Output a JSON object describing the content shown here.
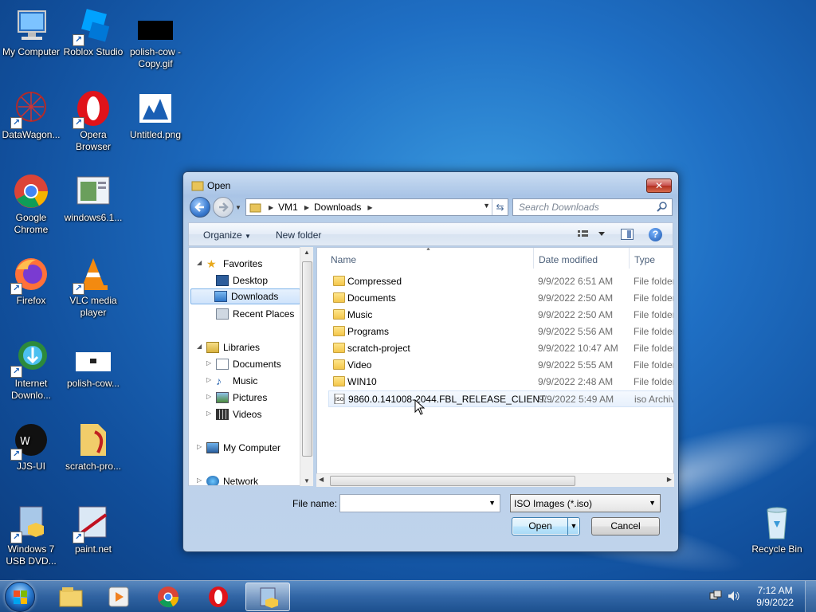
{
  "desktop": {
    "icons": [
      {
        "label": "My Computer",
        "icon": "computer-icon"
      },
      {
        "label": "Roblox Studio",
        "icon": "roblox-studio-icon"
      },
      {
        "label": "polish-cow - Copy.gif",
        "icon": "gif-thumbnail-icon"
      },
      {
        "label": "DataWagon...",
        "icon": "datawagon-icon"
      },
      {
        "label": "Opera Browser",
        "icon": "opera-icon"
      },
      {
        "label": "Untitled.png",
        "icon": "png-thumbnail-icon"
      },
      {
        "label": "Google Chrome",
        "icon": "chrome-icon"
      },
      {
        "label": "windows6.1...",
        "icon": "installer-icon"
      },
      {
        "label": "Firefox",
        "icon": "firefox-icon"
      },
      {
        "label": "VLC media player",
        "icon": "vlc-icon"
      },
      {
        "label": "Internet Downlo...",
        "icon": "idm-icon"
      },
      {
        "label": "polish-cow...",
        "icon": "gif-thumbnail-icon"
      },
      {
        "label": "JJS-UI",
        "icon": "jjs-ui-icon"
      },
      {
        "label": "scratch-pro...",
        "icon": "folder-icon"
      },
      {
        "label": "Windows 7 USB DVD...",
        "icon": "usb-dvd-tool-icon"
      },
      {
        "label": "paint.net",
        "icon": "paintnet-icon"
      },
      {
        "label": "Recycle Bin",
        "icon": "recycle-bin-icon"
      }
    ]
  },
  "dialog": {
    "title": "Open",
    "breadcrumb": [
      "VM1",
      "Downloads"
    ],
    "search_placeholder": "Search Downloads",
    "toolbar": {
      "organize": "Organize",
      "new_folder": "New folder"
    },
    "nav": {
      "favorites": "Favorites",
      "desktop": "Desktop",
      "downloads": "Downloads",
      "recent_places": "Recent Places",
      "libraries": "Libraries",
      "documents": "Documents",
      "music": "Music",
      "pictures": "Pictures",
      "videos": "Videos",
      "my_computer": "My Computer",
      "network": "Network"
    },
    "columns": {
      "name": "Name",
      "date": "Date modified",
      "type": "Type"
    },
    "files": [
      {
        "name": "Compressed",
        "date": "9/9/2022 6:51 AM",
        "type": "File folder"
      },
      {
        "name": "Documents",
        "date": "9/9/2022 2:50 AM",
        "type": "File folder"
      },
      {
        "name": "Music",
        "date": "9/9/2022 2:50 AM",
        "type": "File folder"
      },
      {
        "name": "Programs",
        "date": "9/9/2022 5:56 AM",
        "type": "File folder"
      },
      {
        "name": "scratch-project",
        "date": "9/9/2022 10:47 AM",
        "type": "File folder"
      },
      {
        "name": "Video",
        "date": "9/9/2022 5:55 AM",
        "type": "File folder"
      },
      {
        "name": "WIN10",
        "date": "9/9/2022 2:48 AM",
        "type": "File folder"
      },
      {
        "name": "9860.0.141008-2044.FBL_RELEASE_CLIENT...",
        "date": "9/9/2022 5:49 AM",
        "type": "iso Archive"
      }
    ],
    "file_name_label": "File name:",
    "file_name_value": "",
    "file_type": "ISO Images (*.iso)",
    "open_label": "Open",
    "cancel_label": "Cancel"
  },
  "taskbar": {
    "time": "7:12 AM",
    "date": "9/9/2022"
  }
}
